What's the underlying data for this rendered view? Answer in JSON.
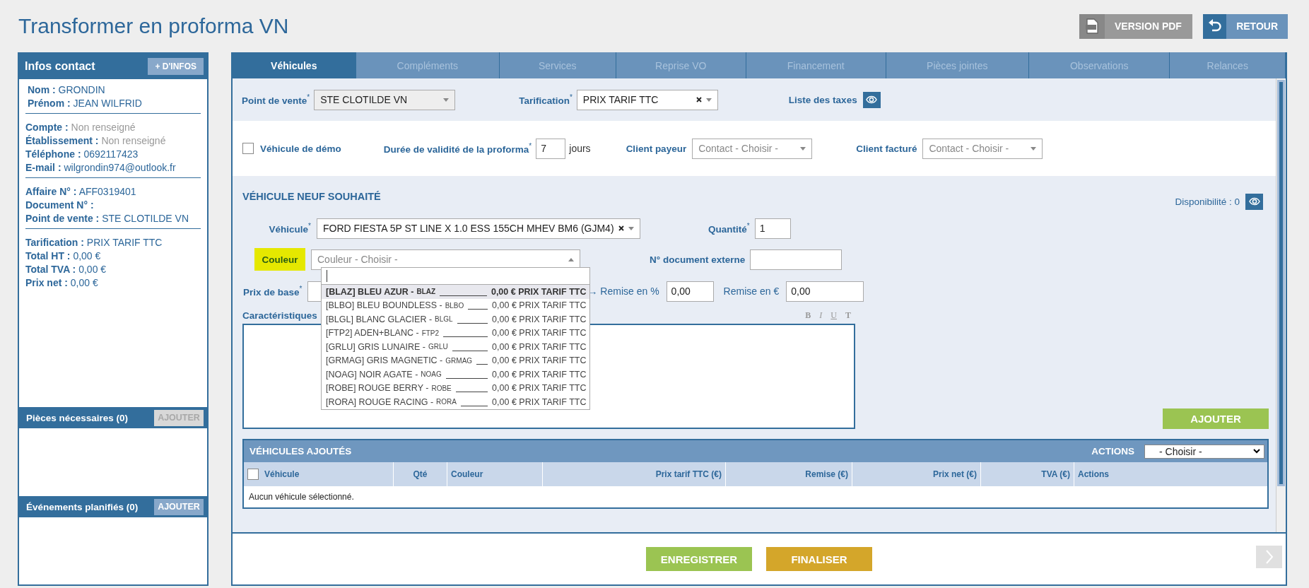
{
  "header": {
    "title": "Transformer en proforma VN",
    "buttons": [
      {
        "label": "VERSION PDF",
        "kind": "pdf"
      },
      {
        "label": "RETOUR",
        "kind": "back"
      }
    ]
  },
  "contact": {
    "title": "Infos contact",
    "more_button": "+ D'INFOS",
    "groups": [
      [
        {
          "label": "Nom :",
          "value": "GRONDIN",
          "muted": false
        },
        {
          "label": "Prénom :",
          "value": "JEAN WILFRID",
          "muted": false
        }
      ],
      [
        {
          "label": "Compte :",
          "value": "Non renseigné",
          "muted": true
        },
        {
          "label": "Établissement :",
          "value": "Non renseigné",
          "muted": true
        },
        {
          "label": "Téléphone :",
          "value": "0692117423",
          "muted": false
        },
        {
          "label": "E-mail :",
          "value": "wilgrondin974@outlook.fr",
          "muted": false
        }
      ],
      [
        {
          "label": "Affaire N° :",
          "value": "AFF0319401",
          "muted": false
        },
        {
          "label": "Document N° :"
        },
        {
          "label": "Point de vente :",
          "value": "STE CLOTILDE VN",
          "muted": false
        }
      ],
      [
        {
          "label": "Tarification :",
          "value": "PRIX TARIF TTC",
          "muted": false
        },
        {
          "label": "Total HT :",
          "value": "0,00 €",
          "muted": false
        },
        {
          "label": "Total TVA :",
          "value": "0,00 €",
          "muted": false
        },
        {
          "label": "Prix net :",
          "value": "0,00 €",
          "muted": false
        }
      ]
    ]
  },
  "side_panels": [
    {
      "title": "Pièces nécessaires (0)",
      "button": "AJOUTER",
      "disabled": true
    },
    {
      "title": "Événements planifiés (0)",
      "button": "AJOUTER",
      "disabled": false
    }
  ],
  "tabs": [
    {
      "label": "Véhicules",
      "selected": true
    },
    {
      "label": "Compléments",
      "selected": false
    },
    {
      "label": "Services",
      "selected": false
    },
    {
      "label": "Reprise VO",
      "selected": false
    },
    {
      "label": "Financement",
      "selected": false
    },
    {
      "label": "Pièces jointes",
      "selected": false
    },
    {
      "label": "Observations",
      "selected": false
    },
    {
      "label": "Relances",
      "selected": false
    }
  ],
  "sale_row": {
    "point_de_vente": {
      "label": "Point de vente$^{*}$",
      "value": "STE CLOTILDE VN",
      "disabled": true
    },
    "tarification": {
      "label": "Tarification$^{*}$",
      "value": "PRIX TARIF TTC"
    },
    "taxes_label": "Liste des taxes"
  },
  "options_row": {
    "demo": {
      "label": "Véhicule de démo",
      "checked": false
    },
    "validity": {
      "label": "Durée de validité de la proforma$^{*}$",
      "value": "7",
      "unit": "jours"
    },
    "payer": {
      "label": "Client payeur",
      "placeholder": "Contact - Choisir -"
    },
    "billed": {
      "label": "Client facturé",
      "placeholder": "Contact - Choisir -"
    }
  },
  "vehicle_section": {
    "title": "VÉHICULE NEUF SOUHAITÉ",
    "availability": "Disponibilité : 0",
    "vehicle": {
      "label": "Véhicule$^{*}$",
      "value": "FORD FIESTA 5P ST LINE X 1.0 ESS 155CH MHEV BM6 (GJM4)"
    },
    "quantity": {
      "label": "Quantité$^{*}$",
      "value": "1"
    },
    "color": {
      "label": "Couleur",
      "highlighted": true,
      "placeholder": "Couleur - Choisir -",
      "expanded": true,
      "options": [
        {
          "name": "[BLAZ] BLEU AZUR -",
          "code": "BLAZ",
          "price": "0,00 € PRIX TARIF TTC",
          "selected": true
        },
        {
          "name": "[BLBO] BLEU BOUNDLESS -",
          "code": "BLBO",
          "price": "0,00 € PRIX TARIF TTC",
          "selected": false
        },
        {
          "name": "[BLGL] BLANC GLACIER -",
          "code": "BLGL",
          "price": "0,00 € PRIX TARIF TTC",
          "selected": false
        },
        {
          "name": "[FTP2] ADEN+BLANC -",
          "code": "FTP2",
          "price": "0,00 € PRIX TARIF TTC",
          "selected": false
        },
        {
          "name": "[GRLU] GRIS LUNAIRE -",
          "code": "GRLU",
          "price": "0,00 € PRIX TARIF TTC",
          "selected": false
        },
        {
          "name": "[GRMAG] GRIS MAGNETIC -",
          "code": "GRMAG",
          "price": "0,00 € PRIX TARIF TTC",
          "selected": false
        },
        {
          "name": "[NOAG] NOIR AGATE -",
          "code": "NOAG",
          "price": "0,00 € PRIX TARIF TTC",
          "selected": false
        },
        {
          "name": "[ROBE] ROUGE BERRY -",
          "code": "ROBE",
          "price": "0,00 € PRIX TARIF TTC",
          "selected": false
        },
        {
          "name": "[RORA] ROUGE RACING -",
          "code": "RORA",
          "price": "0,00 € PRIX TARIF TTC",
          "selected": false
        }
      ]
    },
    "external_doc": {
      "label": "N° document externe"
    },
    "base_price": {
      "label": "Prix de base$^{*}$"
    },
    "discount_pct": {
      "label": "→ Remise en %",
      "value": "0,00"
    },
    "discount_eur": {
      "label": "Remise en €",
      "value": "0,00"
    },
    "features": {
      "label": "Caractéristiques",
      "tools": [
        "B",
        "I",
        "U",
        "T"
      ]
    },
    "add_button": "AJOUTER"
  },
  "added": {
    "title": "VÉHICULES AJOUTÉS",
    "actions_label": "ACTIONS",
    "actions_value": "- Choisir -",
    "select_all_checked": false,
    "columns": [
      "Véhicule",
      "Qté",
      "Couleur",
      "Prix tarif TTC (€)",
      "Remise (€)",
      "Prix net (€)",
      "TVA (€)",
      "Actions"
    ],
    "empty": "Aucun véhicule sélectionné."
  },
  "footer": {
    "buttons": [
      {
        "label": "ENREGISTRER",
        "kind": "save"
      },
      {
        "label": "FINALISER",
        "kind": "finish"
      }
    ]
  }
}
